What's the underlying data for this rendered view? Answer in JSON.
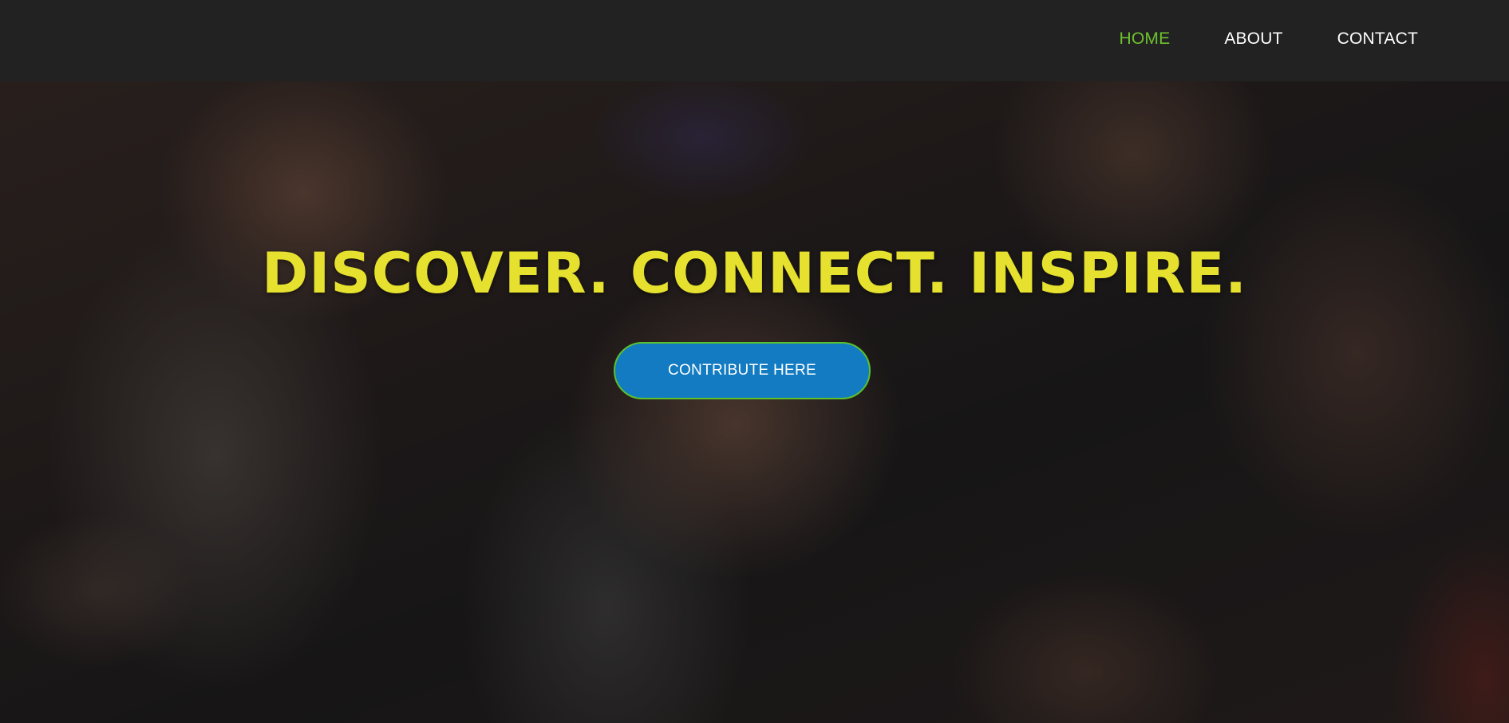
{
  "navbar": {
    "items": [
      {
        "label": "HOME",
        "active": true
      },
      {
        "label": "ABOUT",
        "active": false
      },
      {
        "label": "CONTACT",
        "active": false
      }
    ],
    "active_color": "#6dc22e",
    "background_color": "#222222"
  },
  "hero": {
    "headline": "DISCOVER. CONNECT. INSPIRE.",
    "headline_color": "#e6e12e",
    "cta_label": "CONTRIBUTE HERE",
    "cta_color": "#137bc2",
    "cta_border_color": "#5cc12b"
  }
}
